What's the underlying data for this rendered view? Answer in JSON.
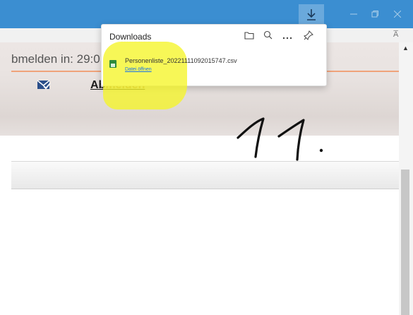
{
  "browser": {
    "download_icon": "download-arrow-icon",
    "minimize_icon": "minimize-icon",
    "restore_icon": "restore-icon",
    "close_icon": "close-icon",
    "read_aloud_label": "A̅"
  },
  "page": {
    "logout_timer": "bmelden in: 29:0",
    "logout_link_visible": "Ab",
    "logout_link_obscured": "melden",
    "mail_icon": "mail-check-icon",
    "accent_color": "#f0a37a"
  },
  "downloads_panel": {
    "title": "Downloads",
    "icons": [
      "folder-icon",
      "search-icon",
      "more-icon",
      "pin-icon"
    ],
    "items": [
      {
        "file_name": "Personenliste_20221111092015747.csv",
        "action_label": "Datei öffnen",
        "file_icon": "csv-file-icon"
      }
    ]
  },
  "annotation": {
    "handwritten_text": "11."
  },
  "colors": {
    "titlebar": "#3b8ed1",
    "highlight": "#f5f528",
    "link": "#1a73e8"
  }
}
